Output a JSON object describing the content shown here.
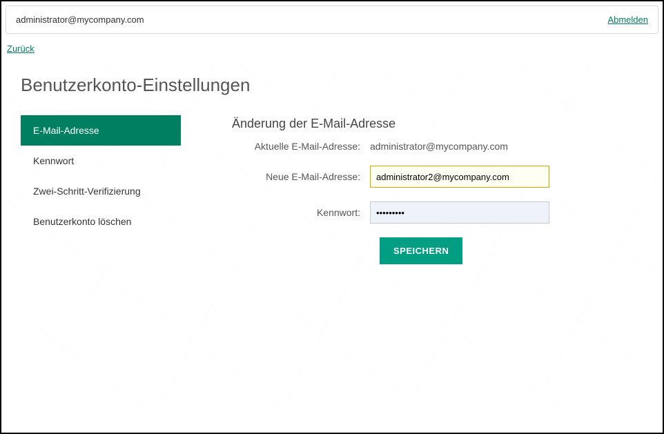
{
  "header": {
    "user_email": "administrator@mycompany.com",
    "logout_label": "Abmelden"
  },
  "back_label": "Zurück",
  "page_title": "Benutzerkonto-Einstellungen",
  "sidebar": {
    "items": [
      {
        "label": "E-Mail-Adresse",
        "active": true
      },
      {
        "label": "Kennwort",
        "active": false
      },
      {
        "label": "Zwei-Schritt-Verifizierung",
        "active": false
      },
      {
        "label": "Benutzerkonto löschen",
        "active": false
      }
    ]
  },
  "form": {
    "section_title": "Änderung der E-Mail-Adresse",
    "current_email_label": "Aktuelle E-Mail-Adresse:",
    "current_email_value": "administrator@mycompany.com",
    "new_email_label": "Neue E-Mail-Adresse:",
    "new_email_value": "administrator2@mycompany.com",
    "password_label": "Kennwort:",
    "password_value": "•••••••••",
    "submit_label": "Speichern"
  }
}
